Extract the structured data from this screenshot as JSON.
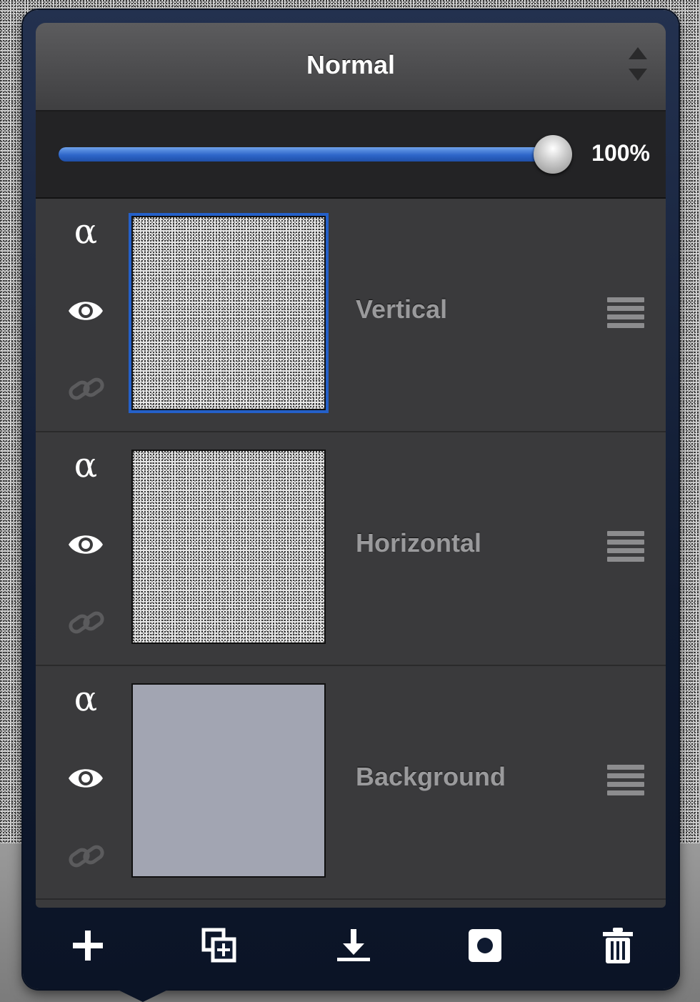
{
  "blend_mode": {
    "label": "Normal"
  },
  "opacity": {
    "value": 1.0,
    "label": "100%"
  },
  "layers": [
    {
      "name": "Vertical",
      "selected": true,
      "thumbnail": "noise",
      "alpha_icon": "α",
      "visible": true
    },
    {
      "name": "Horizontal",
      "selected": false,
      "thumbnail": "noise",
      "alpha_icon": "α",
      "visible": true
    },
    {
      "name": "Background",
      "selected": false,
      "thumbnail": "solid",
      "alpha_icon": "α",
      "visible": true
    }
  ],
  "toolbar": {
    "buttons": [
      "add-layer-icon",
      "duplicate-layer-icon",
      "merge-down-icon",
      "layer-mask-icon",
      "trash-icon"
    ]
  },
  "colors": {
    "accent": "#2e66c9",
    "background_layer_fill": "#a2a5b2",
    "panel": "#3a3a3c",
    "layer_name": "#9a9a9c"
  }
}
